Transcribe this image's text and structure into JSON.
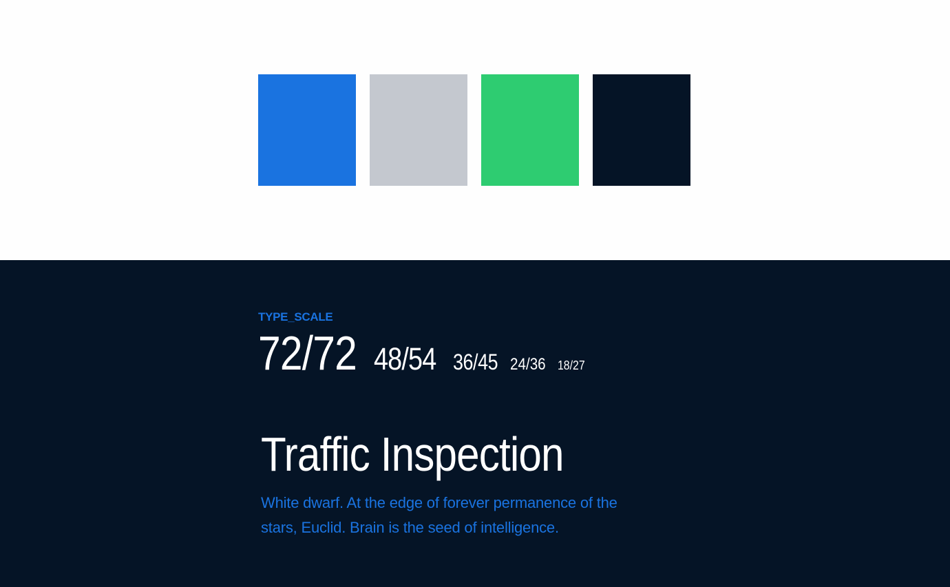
{
  "palette": {
    "swatches": [
      {
        "color": "#1a73e0"
      },
      {
        "color": "#c4c8cf"
      },
      {
        "color": "#2ecc71"
      },
      {
        "color": "#051426"
      }
    ]
  },
  "type_section": {
    "label": "TYPE_SCALE",
    "scale": [
      "72/72",
      "48/54",
      "36/45",
      "24/36",
      "18/27"
    ],
    "headline": "Traffic Inspection",
    "body": "White dwarf. At the edge of forever permanence of the stars, Euclid. Brain is the seed of intelligence.",
    "colors": {
      "background": "#051426",
      "accent": "#1a73e0",
      "text": "#ffffff"
    }
  }
}
